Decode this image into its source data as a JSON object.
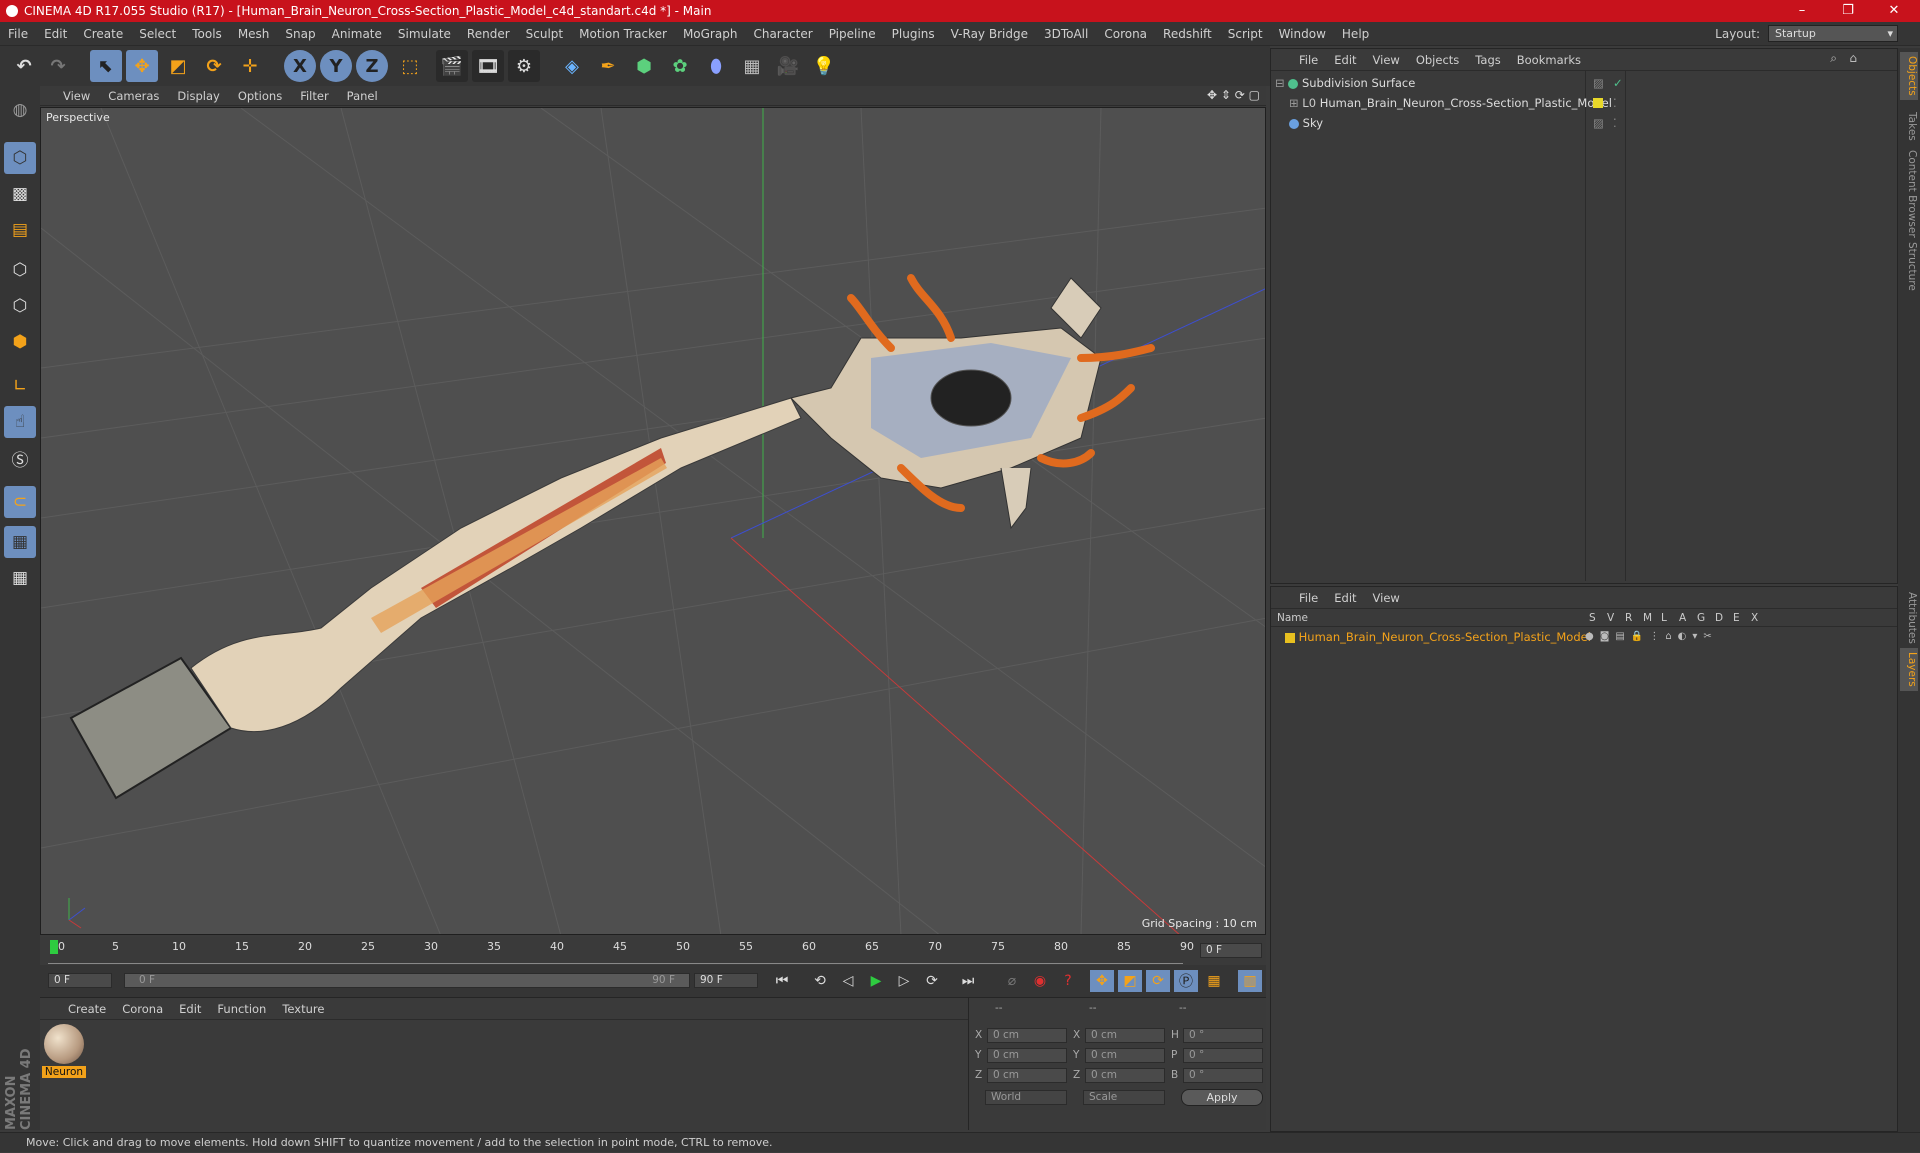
{
  "window": {
    "title": "CINEMA 4D R17.055 Studio (R17) - [Human_Brain_Neuron_Cross-Section_Plastic_Model_c4d_standart.c4d *] - Main",
    "minimize": "–",
    "maximize": "❐",
    "close": "✕"
  },
  "menu": [
    "File",
    "Edit",
    "Create",
    "Select",
    "Tools",
    "Mesh",
    "Snap",
    "Animate",
    "Simulate",
    "Render",
    "Sculpt",
    "Motion Tracker",
    "MoGraph",
    "Character",
    "Pipeline",
    "Plugins",
    "V-Ray Bridge",
    "3DToAll",
    "Corona",
    "Redshift",
    "Script",
    "Window",
    "Help"
  ],
  "layout": {
    "label": "Layout:",
    "value": "Startup"
  },
  "toolbar": {
    "x": "X",
    "y": "Y",
    "z": "Z"
  },
  "viewport": {
    "menu": [
      "View",
      "Cameras",
      "Display",
      "Options",
      "Filter",
      "Panel"
    ],
    "label": "Perspective",
    "grid_spacing": "Grid Spacing : 10 cm"
  },
  "timeline": {
    "ticks": [
      "0",
      "5",
      "10",
      "15",
      "20",
      "25",
      "30",
      "35",
      "40",
      "45",
      "50",
      "55",
      "60",
      "65",
      "70",
      "75",
      "80",
      "85",
      "90"
    ],
    "current_frame": "0 F",
    "start": "0 F",
    "range_start": "0 F",
    "range_end": "90 F",
    "end": "90 F"
  },
  "material_manager": {
    "menu": [
      "Create",
      "Corona",
      "Edit",
      "Function",
      "Texture"
    ],
    "materials": [
      {
        "name": "Neuron"
      }
    ]
  },
  "coordinates": {
    "headers": [
      "--",
      "--",
      "--"
    ],
    "rows": [
      {
        "a": "X",
        "av": "0 cm",
        "b": "X",
        "bv": "0 cm",
        "c": "H",
        "cv": "0 °"
      },
      {
        "a": "Y",
        "av": "0 cm",
        "b": "Y",
        "bv": "0 cm",
        "c": "P",
        "cv": "0 °"
      },
      {
        "a": "Z",
        "av": "0 cm",
        "b": "Z",
        "bv": "0 cm",
        "c": "B",
        "cv": "0 °"
      }
    ],
    "mode1": "World",
    "mode2": "Scale",
    "apply": "Apply"
  },
  "object_manager": {
    "menu": [
      "File",
      "Edit",
      "View",
      "Objects",
      "Tags",
      "Bookmarks"
    ],
    "objects": [
      {
        "name": "Subdivision Surface",
        "color": "#4fc08d"
      },
      {
        "name": "Human_Brain_Neuron_Cross-Section_Plastic_Model",
        "color": "#e8d82a"
      },
      {
        "name": "Sky",
        "color": "#6aa0e0"
      }
    ]
  },
  "layer_manager": {
    "menu": [
      "File",
      "Edit",
      "View"
    ],
    "columns": [
      "Name",
      "S",
      "V",
      "R",
      "M",
      "L",
      "A",
      "G",
      "D",
      "E",
      "X"
    ],
    "layers": [
      {
        "name": "Human_Brain_Neuron_Cross-Section_Plastic_Model",
        "color": "#e8c020"
      }
    ]
  },
  "right_tabs": [
    "Objects",
    "Takes",
    "Content Browser",
    "Structure",
    "Attributes",
    "Layers"
  ],
  "status": "Move: Click and drag to move elements. Hold down SHIFT to quantize movement / add to the selection in point mode, CTRL to remove.",
  "branding": "MAXON CINEMA 4D"
}
